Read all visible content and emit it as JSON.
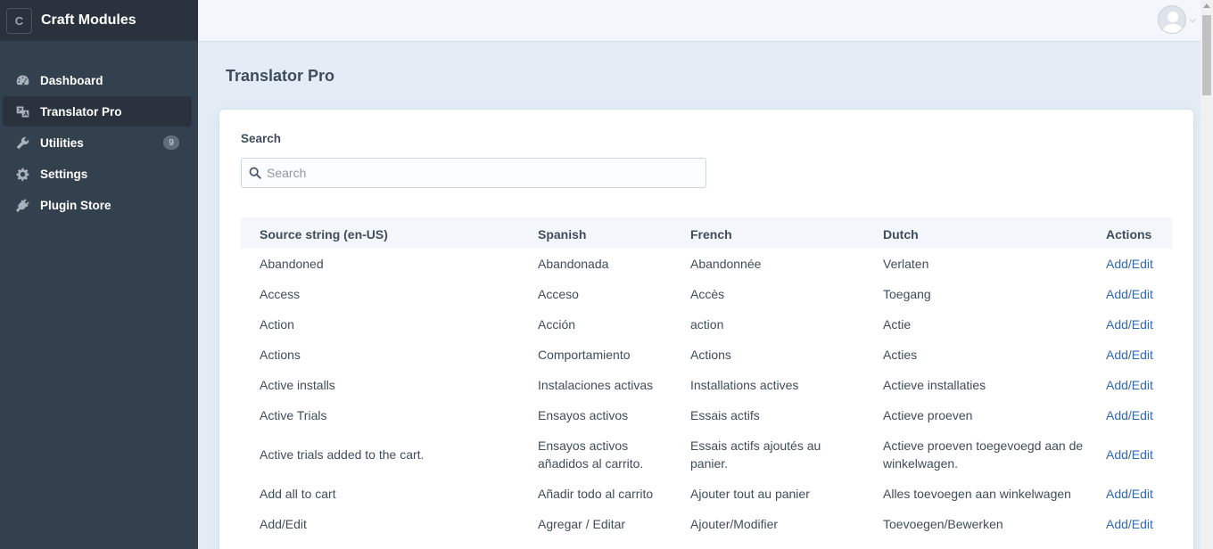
{
  "brand": {
    "logo_letter": "C",
    "name": "Craft Modules"
  },
  "nav": [
    {
      "label": "Dashboard",
      "icon": "gauge-icon"
    },
    {
      "label": "Translator Pro",
      "icon": "translate-icon",
      "active": true
    },
    {
      "label": "Utilities",
      "icon": "wrench-icon",
      "badge": "9"
    },
    {
      "label": "Settings",
      "icon": "gear-icon"
    },
    {
      "label": "Plugin Store",
      "icon": "plug-icon"
    }
  ],
  "page": {
    "title": "Translator Pro"
  },
  "search": {
    "label": "Search",
    "placeholder": "Search"
  },
  "table": {
    "headers": [
      "Source string (en-US)",
      "Spanish",
      "French",
      "Dutch",
      "Actions"
    ],
    "rows": [
      [
        "Abandoned",
        "Abandonada",
        "Abandonnée",
        "Verlaten",
        "Add/Edit"
      ],
      [
        "Access",
        "Acceso",
        "Accès",
        "Toegang",
        "Add/Edit"
      ],
      [
        "Action",
        "Acción",
        "action",
        "Actie",
        "Add/Edit"
      ],
      [
        "Actions",
        "Comportamiento",
        "Actions",
        "Acties",
        "Add/Edit"
      ],
      [
        "Active installs",
        "Instalaciones activas",
        "Installations actives",
        "Actieve installaties",
        "Add/Edit"
      ],
      [
        "Active Trials",
        "Ensayos activos",
        "Essais actifs",
        "Actieve proeven",
        "Add/Edit"
      ],
      [
        "Active trials added to the cart.",
        "Ensayos activos añadidos al carrito.",
        "Essais actifs ajoutés au panier.",
        "Actieve proeven toegevoegd aan de winkelwagen.",
        "Add/Edit"
      ],
      [
        "Add all to cart",
        "Añadir todo al carrito",
        "Ajouter tout au panier",
        "Alles toevoegen aan winkelwagen",
        "Add/Edit"
      ],
      [
        "Add/Edit",
        "Agregar / Editar",
        "Ajouter/Modifier",
        "Toevoegen/Bewerken",
        "Add/Edit"
      ]
    ]
  },
  "colors": {
    "sidebar": "#33404d",
    "link": "#2e6bb2",
    "background": "#e4edf6"
  }
}
